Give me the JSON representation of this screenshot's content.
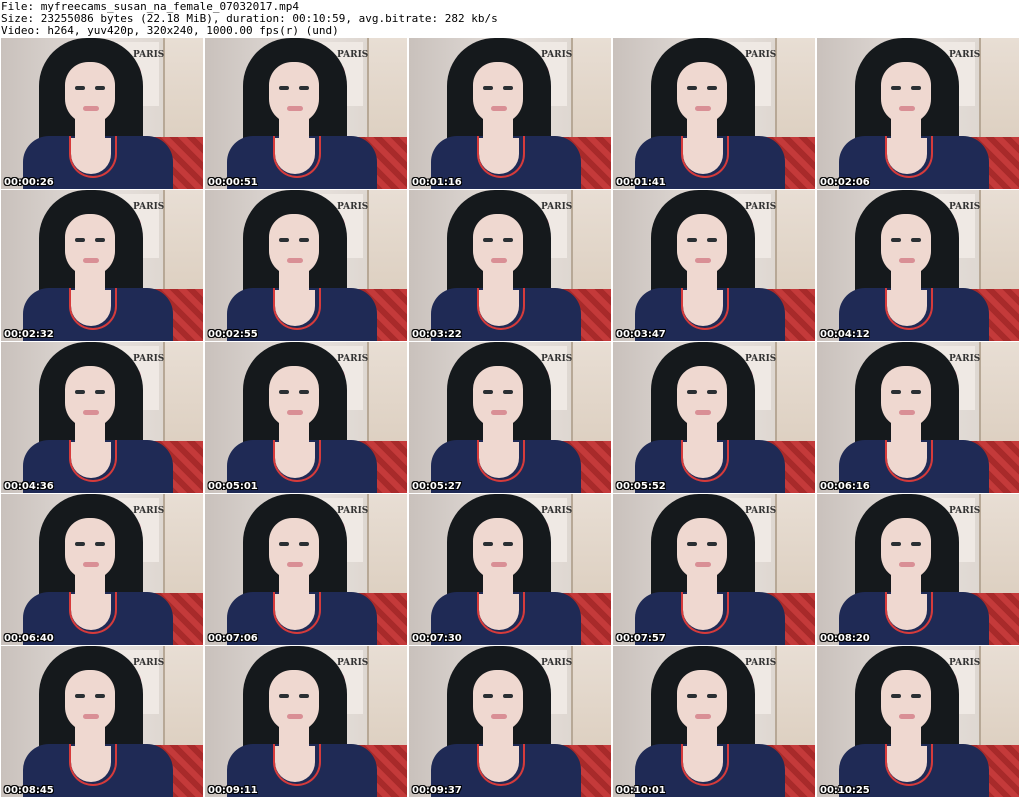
{
  "header": {
    "file_line": "File: myfreecams_susan_na_female_07032017.mp4",
    "size_line": "Size: 23255086 bytes (22.18 MiB), duration: 00:10:59, avg.bitrate: 282 kb/s",
    "video_line": "Video: h264, yuv420p, 320x240, 1000.00 fps(r) (und)"
  },
  "poster_text": "PARIS",
  "thumbnails": [
    {
      "time": "00:00:26"
    },
    {
      "time": "00:00:51"
    },
    {
      "time": "00:01:16"
    },
    {
      "time": "00:01:41"
    },
    {
      "time": "00:02:06"
    },
    {
      "time": "00:02:32"
    },
    {
      "time": "00:02:55"
    },
    {
      "time": "00:03:22"
    },
    {
      "time": "00:03:47"
    },
    {
      "time": "00:04:12"
    },
    {
      "time": "00:04:36"
    },
    {
      "time": "00:05:01"
    },
    {
      "time": "00:05:27"
    },
    {
      "time": "00:05:52"
    },
    {
      "time": "00:06:16"
    },
    {
      "time": "00:06:40"
    },
    {
      "time": "00:07:06"
    },
    {
      "time": "00:07:30"
    },
    {
      "time": "00:07:57"
    },
    {
      "time": "00:08:20"
    },
    {
      "time": "00:08:45"
    },
    {
      "time": "00:09:11"
    },
    {
      "time": "00:09:37"
    },
    {
      "time": "00:10:01"
    },
    {
      "time": "00:10:25"
    }
  ],
  "colors": {
    "background": "#ffffff",
    "shirt": "#1f2a55",
    "trim": "#d63b3b",
    "blanket": "#c43a3a"
  }
}
